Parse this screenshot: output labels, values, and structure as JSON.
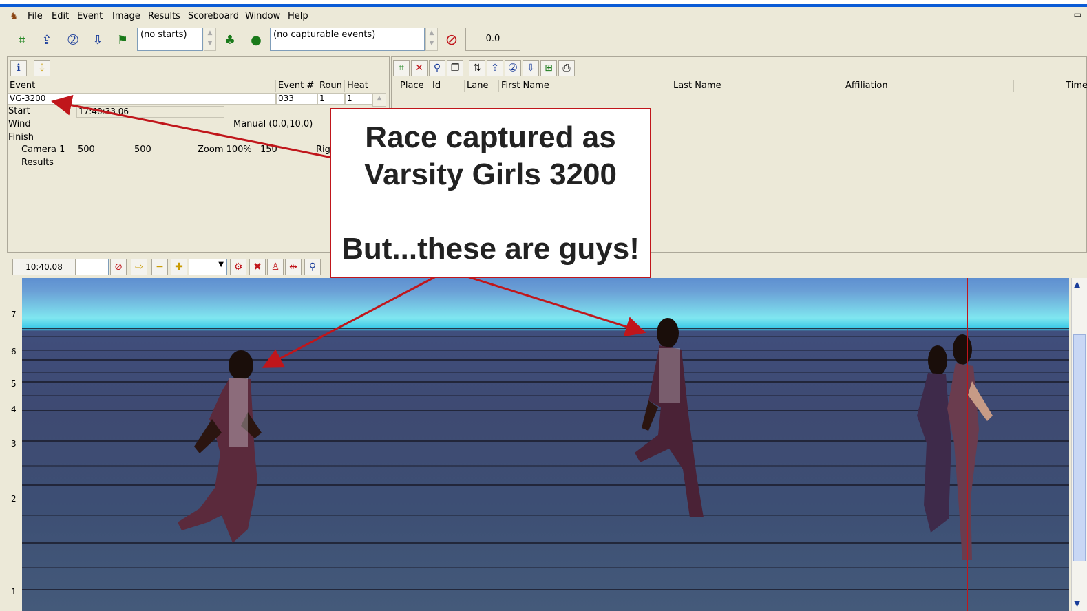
{
  "menu": [
    "File",
    "Edit",
    "Event",
    "Image",
    "Results",
    "Scoreboard",
    "Window",
    "Help"
  ],
  "window_controls": "_ ▭",
  "toolbar": {
    "starts_combo": "(no starts)",
    "events_combo": "(no capturable events)",
    "time_readout": "0.0"
  },
  "event_panel": {
    "headers": {
      "event": "Event",
      "event_num": "Event #",
      "round": "Roun",
      "heat": "Heat"
    },
    "row": {
      "event": "VG-3200",
      "event_num": "033",
      "round": "1",
      "heat": "1"
    },
    "start_label": "Start",
    "start_value": "17:40:33.06",
    "wind_label": "Wind",
    "wind_value": "Manual (0.0,10.0)",
    "finish_label": "Finish",
    "camera_label": "Camera 1",
    "camera_a": "500",
    "camera_b": "500",
    "zoom": "Zoom 100%",
    "camera_c": "150",
    "camera_d": "Rig",
    "results_label": "Results"
  },
  "results_panel": {
    "columns": [
      "Place",
      "Id",
      "Lane",
      "First Name",
      "Last Name",
      "Affiliation",
      "Time"
    ]
  },
  "image_toolbar": {
    "time": "10:40.08"
  },
  "lanes": [
    "7",
    "6",
    "5",
    "4",
    "3",
    "2",
    "1"
  ],
  "callout": {
    "line1": "Race captured as",
    "line2": "Varsity Girls 3200",
    "line3": "But...these are guys!"
  },
  "colors": {
    "arrow": "#c0161b",
    "titlebar": "#0a5bd6"
  }
}
